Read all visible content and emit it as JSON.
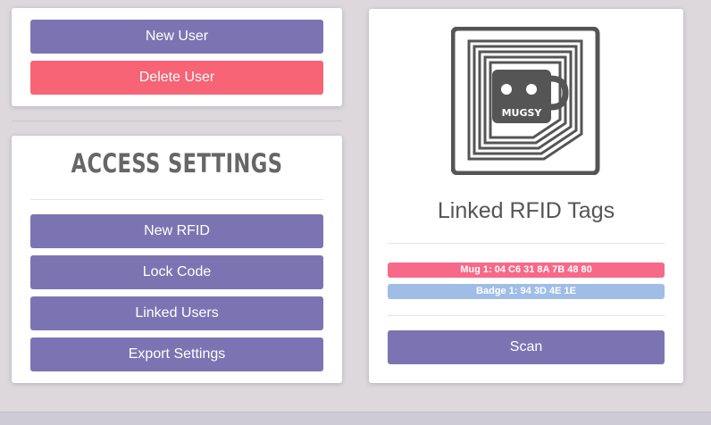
{
  "colors": {
    "primary": "#7c74b2",
    "danger": "#f66475",
    "tag_mug": "#f76989",
    "tag_badge": "#9fbde6",
    "icon": "#555555"
  },
  "user_panel": {
    "new_user_label": "New User",
    "delete_user_label": "Delete User"
  },
  "access_settings": {
    "title": "ACCESS SETTINGS",
    "buttons": [
      {
        "label": "New RFID"
      },
      {
        "label": "Lock Code"
      },
      {
        "label": "Linked Users"
      },
      {
        "label": "Export Settings"
      }
    ]
  },
  "rfid_panel": {
    "icon_text": "MUGSY",
    "title": "Linked RFID Tags",
    "tags": [
      {
        "label": "Mug 1: 04 C6 31 8A 7B 48 80"
      },
      {
        "label": "Badge 1: 94 3D 4E 1E"
      }
    ],
    "scan_label": "Scan"
  }
}
